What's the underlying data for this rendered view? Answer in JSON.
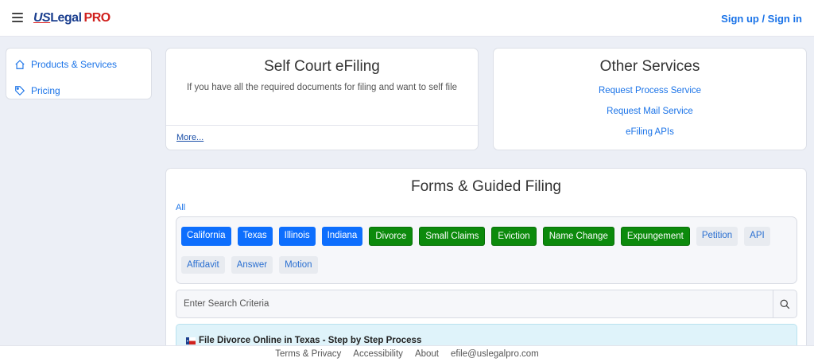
{
  "header": {
    "logo_us": "US",
    "logo_legal": "Legal",
    "logo_pro": "PRO",
    "signin": "Sign up / Sign in"
  },
  "sidebar": {
    "items": [
      {
        "label": "Products & Services",
        "icon": "house-icon"
      },
      {
        "label": "Pricing",
        "icon": "tag-icon"
      }
    ]
  },
  "efiling": {
    "title": "Self Court eFiling",
    "description": "If you have all the required documents for filing and want to self file",
    "more": "More..."
  },
  "other_services": {
    "title": "Other Services",
    "links": [
      "Request Process Service",
      "Request Mail Service",
      "eFiling APIs"
    ]
  },
  "forms": {
    "title": "Forms & Guided Filing",
    "all": "All",
    "chips": [
      {
        "label": "California",
        "style": "blue"
      },
      {
        "label": "Texas",
        "style": "blue"
      },
      {
        "label": "Illinois",
        "style": "blue"
      },
      {
        "label": "Indiana",
        "style": "blue"
      },
      {
        "label": "Divorce",
        "style": "green"
      },
      {
        "label": "Small Claims",
        "style": "green"
      },
      {
        "label": "Eviction",
        "style": "green"
      },
      {
        "label": "Name Change",
        "style": "green"
      },
      {
        "label": "Expungement",
        "style": "green"
      },
      {
        "label": "Petition",
        "style": "light"
      },
      {
        "label": "API",
        "style": "light"
      },
      {
        "label": "Affidavit",
        "style": "light"
      },
      {
        "label": "Answer",
        "style": "light"
      },
      {
        "label": "Motion",
        "style": "light"
      }
    ],
    "search_placeholder": "Enter Search Criteria",
    "result": "File Divorce Online in Texas - Step by Step Process"
  },
  "footer": {
    "links": [
      "Terms & Privacy",
      "Accessibility",
      "About",
      "efile@uslegalpro.com"
    ]
  },
  "colors": {
    "accent": "#1a73e8",
    "chip_blue": "#0d6efd",
    "chip_green": "#0c8a0c",
    "brand_red": "#d0201d"
  }
}
